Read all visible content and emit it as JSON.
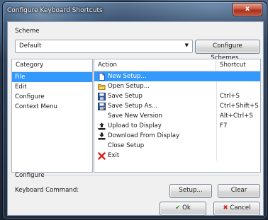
{
  "window": {
    "title": "Configure Keyboard Shortcuts",
    "close_symbol": "x"
  },
  "scheme": {
    "label": "Scheme",
    "selected": "Default",
    "configure_button": "Configure Schemes..."
  },
  "categories": {
    "header": "Category",
    "items": [
      {
        "label": "File",
        "selected": true
      },
      {
        "label": "Edit",
        "selected": false
      },
      {
        "label": "Configure",
        "selected": false
      },
      {
        "label": "Context Menu",
        "selected": false
      }
    ]
  },
  "actions": {
    "header_action": "Action",
    "header_shortcut": "Shortcut",
    "rows": [
      {
        "action": "New Setup...",
        "shortcut": "",
        "icon": "new-file-icon",
        "selected": true
      },
      {
        "action": "Open Setup...",
        "shortcut": "",
        "icon": "open-folder-icon",
        "selected": false
      },
      {
        "action": "Save Setup",
        "shortcut": "Ctrl+S",
        "icon": "save-icon",
        "selected": false
      },
      {
        "action": "Save Setup As...",
        "shortcut": "Ctrl+Shift+S",
        "icon": "save-as-icon",
        "selected": false
      },
      {
        "action": "Save New Version",
        "shortcut": "Alt+Ctrl+S",
        "icon": "",
        "selected": false
      },
      {
        "action": "Upload to Display",
        "shortcut": "F7",
        "icon": "upload-icon",
        "selected": false
      },
      {
        "action": "Download From Display",
        "shortcut": "",
        "icon": "download-icon",
        "selected": false
      },
      {
        "action": "Close Setup",
        "shortcut": "",
        "icon": "",
        "selected": false
      },
      {
        "action": "Exit",
        "shortcut": "",
        "icon": "exit-icon",
        "selected": false
      }
    ]
  },
  "configure": {
    "label": "Configure",
    "keyboard_command_label": "Keyboard Command:",
    "setup_button": "Setup...",
    "clear_button": "Clear"
  },
  "footer": {
    "ok_button": "Ok",
    "cancel_button": "Cancel"
  },
  "colors": {
    "selection": "#3399ff"
  }
}
